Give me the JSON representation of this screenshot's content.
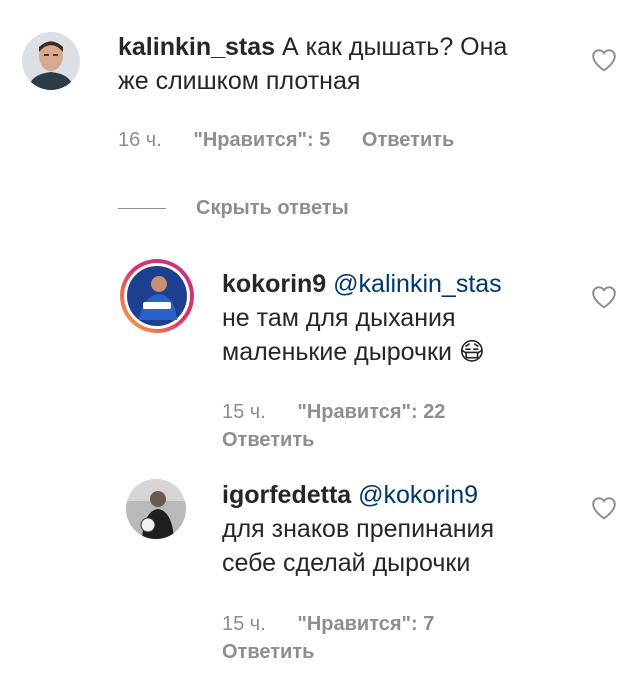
{
  "comments": [
    {
      "username": "kalinkin_stas",
      "mention": "",
      "line1": " А как дышать? Она",
      "line2": "же слишком плотная",
      "line3": "",
      "time": "16 ч.",
      "likes": "\"Нравится\": 5",
      "reply": "Ответить"
    }
  ],
  "hide_replies_label": "Скрыть ответы",
  "replies": [
    {
      "username": "kokorin9",
      "mention": "@kalinkin_stas",
      "line1": "не там для дыхания",
      "line2": "маленькие дырочки 😷",
      "time": "15 ч.",
      "likes": "\"Нравится\": 22",
      "reply": "Ответить",
      "avatar_badge": "КОКОРИН"
    },
    {
      "username": "igorfedetta",
      "mention": "@kokorin9",
      "line1": "для знаков препинания",
      "line2": "себе сделай дырочки",
      "time": "15 ч.",
      "likes": "\"Нравится\": 7",
      "reply": "Ответить"
    }
  ],
  "colors": {
    "text": "#262626",
    "meta": "#8e8e8e",
    "mention": "#00376b",
    "story_ring_start": "#f7b733",
    "story_ring_end": "#d62976"
  }
}
